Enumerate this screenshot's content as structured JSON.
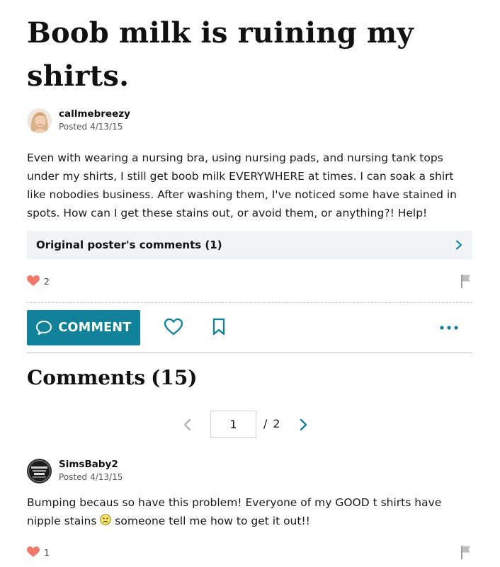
{
  "post": {
    "title": "Boob milk is ruining my shirts.",
    "author": {
      "name": "callmebreezy",
      "posted_label": "Posted",
      "posted_date": "4/13/15"
    },
    "body": "Even with wearing a nursing bra, using nursing pads, and nursing tank tops under my shirts, I still get boob milk EVERYWHERE at times. I can soak a shirt like nobodies business. After washing them, I've noticed some have stained in spots. How can I get these stains out, or avoid them, or anything?! Help!",
    "op_comments_label": "Original poster's comments (1)",
    "like_count": "2"
  },
  "actions": {
    "comment_label": "COMMENT"
  },
  "comments_section": {
    "heading": "Comments",
    "count": "(15)"
  },
  "pagination": {
    "current_page": "1",
    "separator": "/",
    "total_pages": "2"
  },
  "comments": [
    {
      "author": "SimsBaby2",
      "posted_label": "Posted",
      "posted_date": "4/13/15",
      "body_before_emoji": "Bumping becaus so have this problem! Everyone of my GOOD t shirts have nipple stains ",
      "emoji": "frowning-face",
      "body_after_emoji": " someone tell me how to get it out!!",
      "like_count": "1"
    }
  ],
  "colors": {
    "accent": "#12819a",
    "heart": "#f07a6a",
    "flag": "#9e9e9e",
    "op_bar_bg": "#f1f3f4"
  },
  "icons": {
    "comment_button": "speech-bubble-icon",
    "like": "heart-icon",
    "save": "bookmark-icon",
    "more": "more-dots-icon",
    "report": "flag-icon",
    "expand": "chevron-right-icon"
  }
}
